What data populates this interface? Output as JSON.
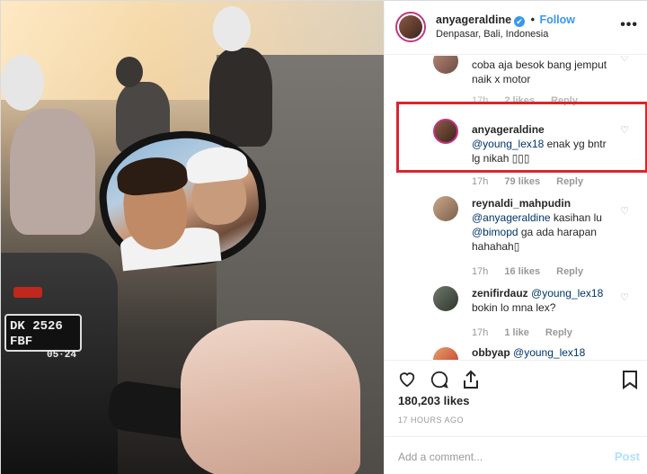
{
  "post": {
    "username": "anyageraldine",
    "verified_mark": "✔",
    "follow_dot": "•",
    "follow_label": "Follow",
    "location": "Denpasar, Bali, Indonesia",
    "more_icon": "more-options-icon"
  },
  "photo": {
    "plate_line1": "DK 2526 FBF",
    "plate_line2": "05·24"
  },
  "comments": [
    {
      "username": "",
      "text": "coba aja besok bang jemput naik x motor",
      "time": "17h",
      "likes": "2 likes",
      "reply": "Reply"
    },
    {
      "username": "anyageraldine",
      "mention": "@young_lex18",
      "text": " enak yg bntr lg nikah ▯▯▯",
      "time": "17h",
      "likes": "79 likes",
      "reply": "Reply"
    },
    {
      "username": "reynaldi_mahpudin",
      "mention": "@anyageraldine",
      "text_a": " kasihan lu ",
      "mention2": "@bimopd",
      "text_b": " ga ada harapan hahahah▯",
      "time": "17h",
      "likes": "16 likes",
      "reply": "Reply"
    },
    {
      "username": "zenifirdauz",
      "mention": "@young_lex18",
      "text": "bokin lo mna lex?",
      "time": "17h",
      "likes": "1 like",
      "reply": "Reply"
    },
    {
      "username": "obbyap",
      "mention": "@young_lex18"
    }
  ],
  "actions": {
    "like_icon": "heart-icon",
    "comment_icon": "comment-icon",
    "share_icon": "share-icon",
    "save_icon": "bookmark-icon"
  },
  "likes_count": "180,203 likes",
  "timestamp": "17 HOURS AGO",
  "add_comment_placeholder": "Add a comment...",
  "post_button": "Post",
  "colors": {
    "accent_blue": "#3897f0",
    "highlight_red": "#d8262e",
    "muted": "#999999"
  }
}
